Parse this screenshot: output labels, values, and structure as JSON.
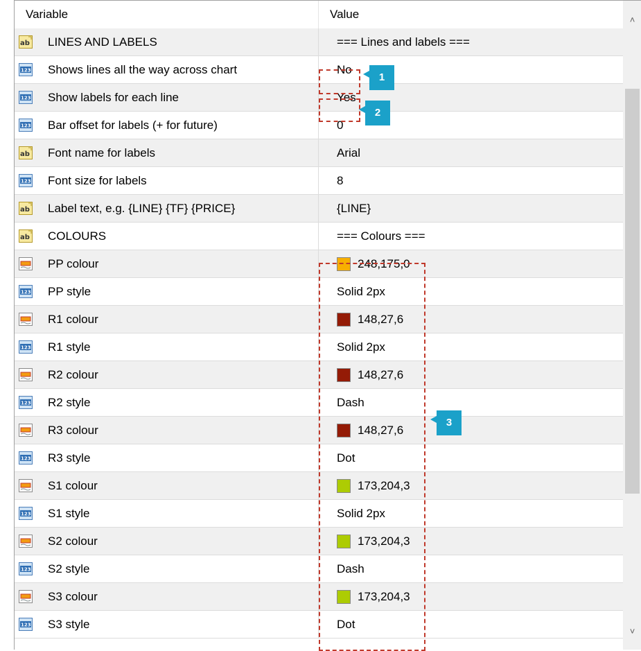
{
  "header": {
    "variable": "Variable",
    "value": "Value"
  },
  "rows": [
    {
      "icon": "ab",
      "name": "LINES AND LABELS",
      "value": "=== Lines and labels ==="
    },
    {
      "icon": "123",
      "name": "Shows lines all the way across chart",
      "value": "No"
    },
    {
      "icon": "123",
      "name": "Show labels for each line",
      "value": "Yes"
    },
    {
      "icon": "123",
      "name": "Bar offset for labels (+ for future)",
      "value": "0"
    },
    {
      "icon": "ab",
      "name": "Font name for labels",
      "value": "Arial"
    },
    {
      "icon": "123",
      "name": "Font size for labels",
      "value": "8"
    },
    {
      "icon": "ab",
      "name": "Label text, e.g. {LINE} {TF} {PRICE}",
      "value": "{LINE}"
    },
    {
      "icon": "ab",
      "name": "COLOURS",
      "value": "=== Colours ==="
    },
    {
      "icon": "color",
      "name": "PP colour",
      "value": "248,175,0",
      "swatch": "#f8af00"
    },
    {
      "icon": "123",
      "name": "PP style",
      "value": "Solid 2px"
    },
    {
      "icon": "color",
      "name": "R1 colour",
      "value": "148,27,6",
      "swatch": "#941b06"
    },
    {
      "icon": "123",
      "name": "R1 style",
      "value": "Solid 2px"
    },
    {
      "icon": "color",
      "name": "R2 colour",
      "value": "148,27,6",
      "swatch": "#941b06"
    },
    {
      "icon": "123",
      "name": "R2 style",
      "value": "Dash"
    },
    {
      "icon": "color",
      "name": "R3 colour",
      "value": "148,27,6",
      "swatch": "#941b06"
    },
    {
      "icon": "123",
      "name": "R3 style",
      "value": "Dot"
    },
    {
      "icon": "color",
      "name": "S1 colour",
      "value": "173,204,3",
      "swatch": "#adcc03"
    },
    {
      "icon": "123",
      "name": "S1 style",
      "value": "Solid 2px"
    },
    {
      "icon": "color",
      "name": "S2 colour",
      "value": "173,204,3",
      "swatch": "#adcc03"
    },
    {
      "icon": "123",
      "name": "S2 style",
      "value": "Dash"
    },
    {
      "icon": "color",
      "name": "S3 colour",
      "value": "173,204,3",
      "swatch": "#adcc03"
    },
    {
      "icon": "123",
      "name": "S3 style",
      "value": "Dot"
    }
  ],
  "callouts": [
    "1",
    "2",
    "3"
  ],
  "colors": {
    "accent_callout": "#1ba1c9",
    "annotation_dash": "#c0392b",
    "row_alt": "#f0f0f0"
  },
  "icons": {
    "ab": "string-param-icon",
    "123": "number-param-icon",
    "color": "color-param-icon"
  }
}
